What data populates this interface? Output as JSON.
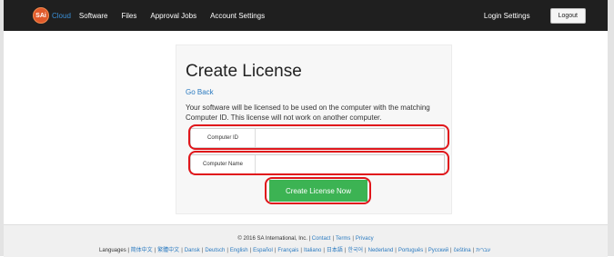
{
  "navbar": {
    "logo_badge": "SAi",
    "logo_text": "Cloud",
    "links": [
      "Software",
      "Files",
      "Approval Jobs",
      "Account Settings"
    ],
    "login_settings": "Login Settings",
    "logout": "Logout"
  },
  "page": {
    "title": "Create License",
    "go_back": "Go Back",
    "description": "Your software will be licensed to be used on the computer with the matching Computer ID. This license will not work on another computer.",
    "computer_id_label": "Computer ID",
    "computer_id_value": "",
    "computer_name_label": "Computer Name",
    "computer_name_value": "",
    "create_button": "Create License Now"
  },
  "footer": {
    "copyright": "© 2016 SA International, Inc. |",
    "links": [
      "Contact",
      "Terms",
      "Privacy"
    ],
    "languages_label": "Languages |",
    "languages": [
      "简体中文",
      "繁體中文",
      "Dansk",
      "Deutsch",
      "English",
      "Español",
      "Français",
      "Italiano",
      "日本語",
      "한국어",
      "Nederland",
      "Português",
      "Русский",
      "čeština",
      "עברית"
    ]
  },
  "colors": {
    "navbar_bg": "#1f1f1f",
    "accent_blue": "#2a7ac0",
    "button_green": "#3cb353",
    "highlight_red": "#e0161b"
  }
}
